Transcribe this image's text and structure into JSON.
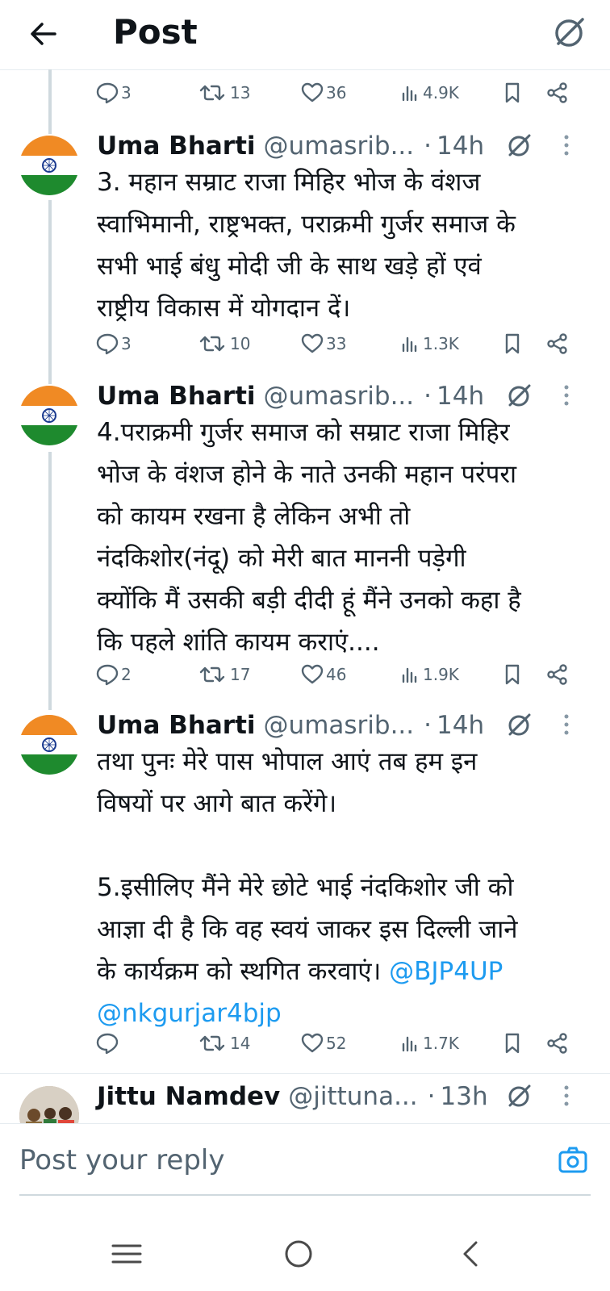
{
  "header": {
    "title": "Post",
    "back_icon": "arrow-left-icon",
    "grok_icon": "grok-icon"
  },
  "prev_actions": {
    "replies": "3",
    "reposts": "13",
    "likes": "36",
    "views": "4.9K"
  },
  "tweets": [
    {
      "name": "Uma Bharti",
      "handle": "@umasrib...",
      "dot": "·",
      "time": "14h",
      "lines": [
        "3. महान सम्राट राजा मिहिर भोज के वंशज",
        "स्वाभिमानी, राष्ट्रभक्त, पराक्रमी गुर्जर समाज के",
        "सभी भाई बंधु मोदी जी के साथ खड़े हों एवं",
        "राष्ट्रीय विकास में योगदान दें।"
      ],
      "actions": {
        "replies": "3",
        "reposts": "10",
        "likes": "33",
        "views": "1.3K"
      }
    },
    {
      "name": "Uma Bharti",
      "handle": "@umasrib...",
      "dot": "·",
      "time": "14h",
      "lines": [
        "4.पराक्रमी गुर्जर समाज को सम्राट राजा मिहिर",
        "भोज के वंशज होने के नाते उनकी महान परंपरा",
        "को कायम रखना है लेकिन अभी तो",
        "नंदकिशोर(नंदू) को मेरी बात माननी पड़ेगी",
        "क्योंकि मैं उसकी बड़ी दीदी हूं मैंने उनको कहा है",
        "कि पहले शांति कायम कराएं...."
      ],
      "actions": {
        "replies": "2",
        "reposts": "17",
        "likes": "46",
        "views": "1.9K"
      }
    },
    {
      "name": "Uma Bharti",
      "handle": "@umasrib...",
      "dot": "·",
      "time": "14h",
      "lines": [
        "तथा पुनः मेरे पास भोपाल आएं तब हम इन",
        "विषयों पर आगे बात करेंगे।",
        "",
        "5.इसीलिए मैंने मेरे छोटे भाई नंदकिशोर जी को",
        "आज्ञा दी है कि वह स्वयं जाकर इस दिल्ली जाने",
        "के कार्यक्रम को स्थगित करवाएं।"
      ],
      "mention1": "@BJP4UP",
      "mention2": "@nkgurjar4bjp",
      "actions": {
        "replies": "",
        "reposts": "14",
        "likes": "52",
        "views": "1.7K"
      }
    },
    {
      "name": "Jittu Namdev",
      "handle": "@jittuna...",
      "dot": "·",
      "time": "13h"
    }
  ],
  "reply": {
    "placeholder": "Post your reply",
    "camera_icon": "camera-icon"
  },
  "navbar": {
    "menu_icon": "menu-icon",
    "home_icon": "circle-home-icon",
    "back_icon": "chevron-left-icon"
  },
  "colors": {
    "text": "#0f1419",
    "muted": "#536471",
    "link": "#1d9bf0",
    "line": "#cfd9de"
  }
}
